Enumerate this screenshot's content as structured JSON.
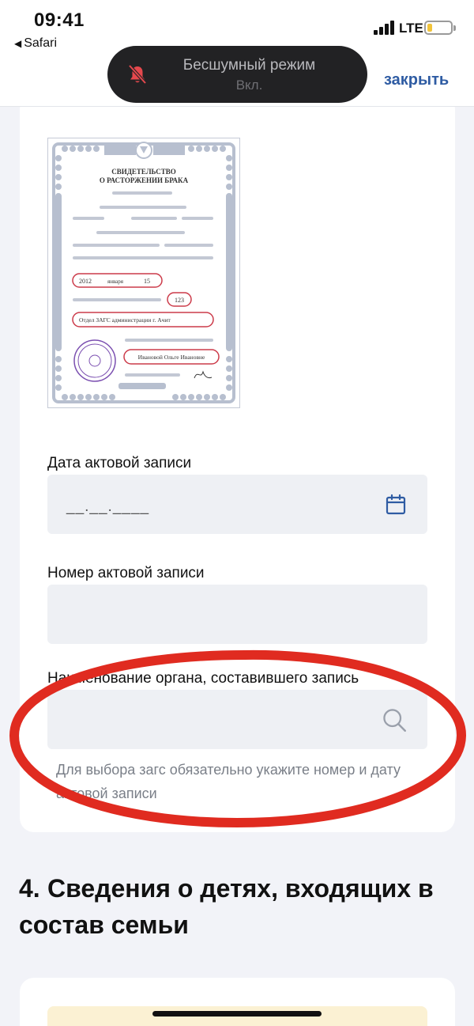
{
  "status_bar": {
    "time": "09:41",
    "back_app": "Safari",
    "network": "LTE",
    "battery_level_fraction": 0.15
  },
  "toast": {
    "title": "Бесшумный режим",
    "subtitle": "Вкл.",
    "icon": "bell-slash-icon",
    "icon_color": "#e5484d"
  },
  "header": {
    "close_label": "закрыть",
    "accent_color": "#2f5ca3"
  },
  "certificate": {
    "title_line1": "СВИДЕТЕЛЬСТВО",
    "title_line2": "О РАСТОРЖЕНИИ БРАКА",
    "year": "2012",
    "month": "января",
    "day": "15",
    "record_number": "123",
    "registry_office": "Отдел ЗАГС администрации г. Ачит",
    "issued_to": "Ивановой Ольге Ивановне",
    "highlight_color": "#cc3b4a"
  },
  "form": {
    "record_date": {
      "label": "Дата актовой записи",
      "mask": "__.__.____",
      "icon": "calendar-icon"
    },
    "record_number": {
      "label": "Номер актовой записи",
      "value": ""
    },
    "authority": {
      "label": "Наименование органа, составившего запись",
      "value": "",
      "icon": "search-icon",
      "hint": "Для выбора загс обязательно укажите номер и дату актовой записи"
    }
  },
  "section4": {
    "number": "4.",
    "title": "Сведения о детях, входящих в состав семьи"
  },
  "annotation": {
    "shape": "ellipse",
    "color": "#e02b20"
  }
}
